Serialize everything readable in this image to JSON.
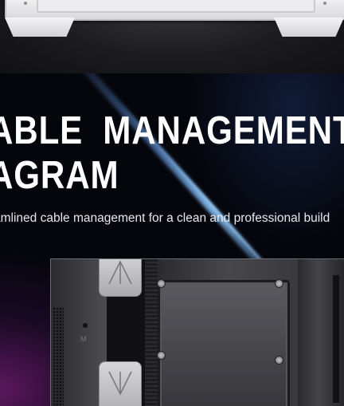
{
  "hero": {
    "title_line1": "ABLE  MANAGEMENT",
    "title_line2": "AGRAM",
    "subtitle": "amlined cable management for a clean and professional build"
  },
  "colors": {
    "background": "#05060c",
    "title": "#ffffff",
    "accent_glow": "#7a1f7a",
    "light_streak": "#8ccaff"
  },
  "images": {
    "top_strip": "white-pc-case-top-view",
    "interior_photo": "pc-case-cable-management-interior"
  }
}
